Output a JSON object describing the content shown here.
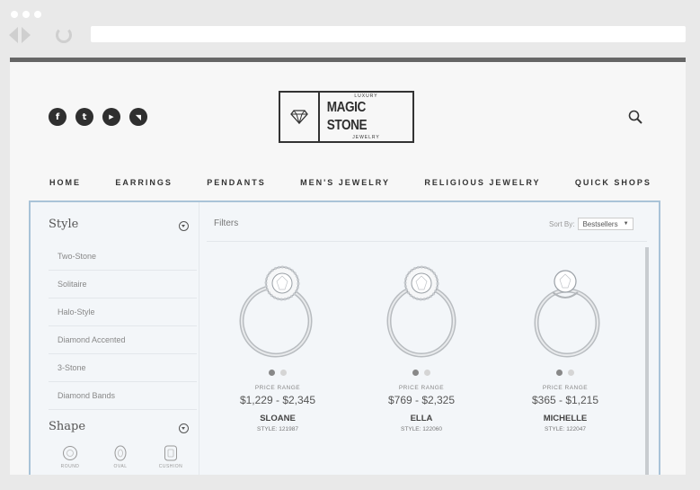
{
  "social": {
    "icons": [
      {
        "name": "facebook-icon",
        "glyph": "f"
      },
      {
        "name": "twitter-icon",
        "glyph": "t"
      },
      {
        "name": "youtube-icon",
        "glyph": "▶"
      },
      {
        "name": "rss-icon",
        "glyph": "◥"
      }
    ]
  },
  "logo": {
    "top": "LUXURY",
    "main": "MAGIC STONE",
    "bottom": "JEWELRY"
  },
  "nav": [
    "HOME",
    "EARRINGS",
    "PENDANTS",
    "MEN'S JEWELRY",
    "RELIGIOUS JEWELRY",
    "QUICK SHOPS"
  ],
  "sidebar": {
    "style_heading": "Style",
    "style_items": [
      "Two-Stone",
      "Solitaire",
      "Halo-Style",
      "Diamond Accented",
      "3-Stone",
      "Diamond Bands"
    ],
    "shape_heading": "Shape",
    "shapes": [
      "ROUND",
      "OVAL",
      "CUSHION"
    ]
  },
  "toolbar": {
    "filters_label": "Filters",
    "sort_label": "Sort By:",
    "sort_value": "Bestsellers"
  },
  "products": [
    {
      "price_label": "PRICE RANGE",
      "price": "$1,229 - $2,345",
      "name": "SLOANE",
      "style": "STYLE: 121987"
    },
    {
      "price_label": "PRICE RANGE",
      "price": "$769 - $2,325",
      "name": "ELLA",
      "style": "STYLE: 122060"
    },
    {
      "price_label": "PRICE RANGE",
      "price": "$365 - $1,215",
      "name": "MICHELLE",
      "style": "STYLE: 122047"
    }
  ],
  "colors": {
    "panel_border": "#a9c3d8",
    "panel_bg": "#f3f6f9"
  }
}
